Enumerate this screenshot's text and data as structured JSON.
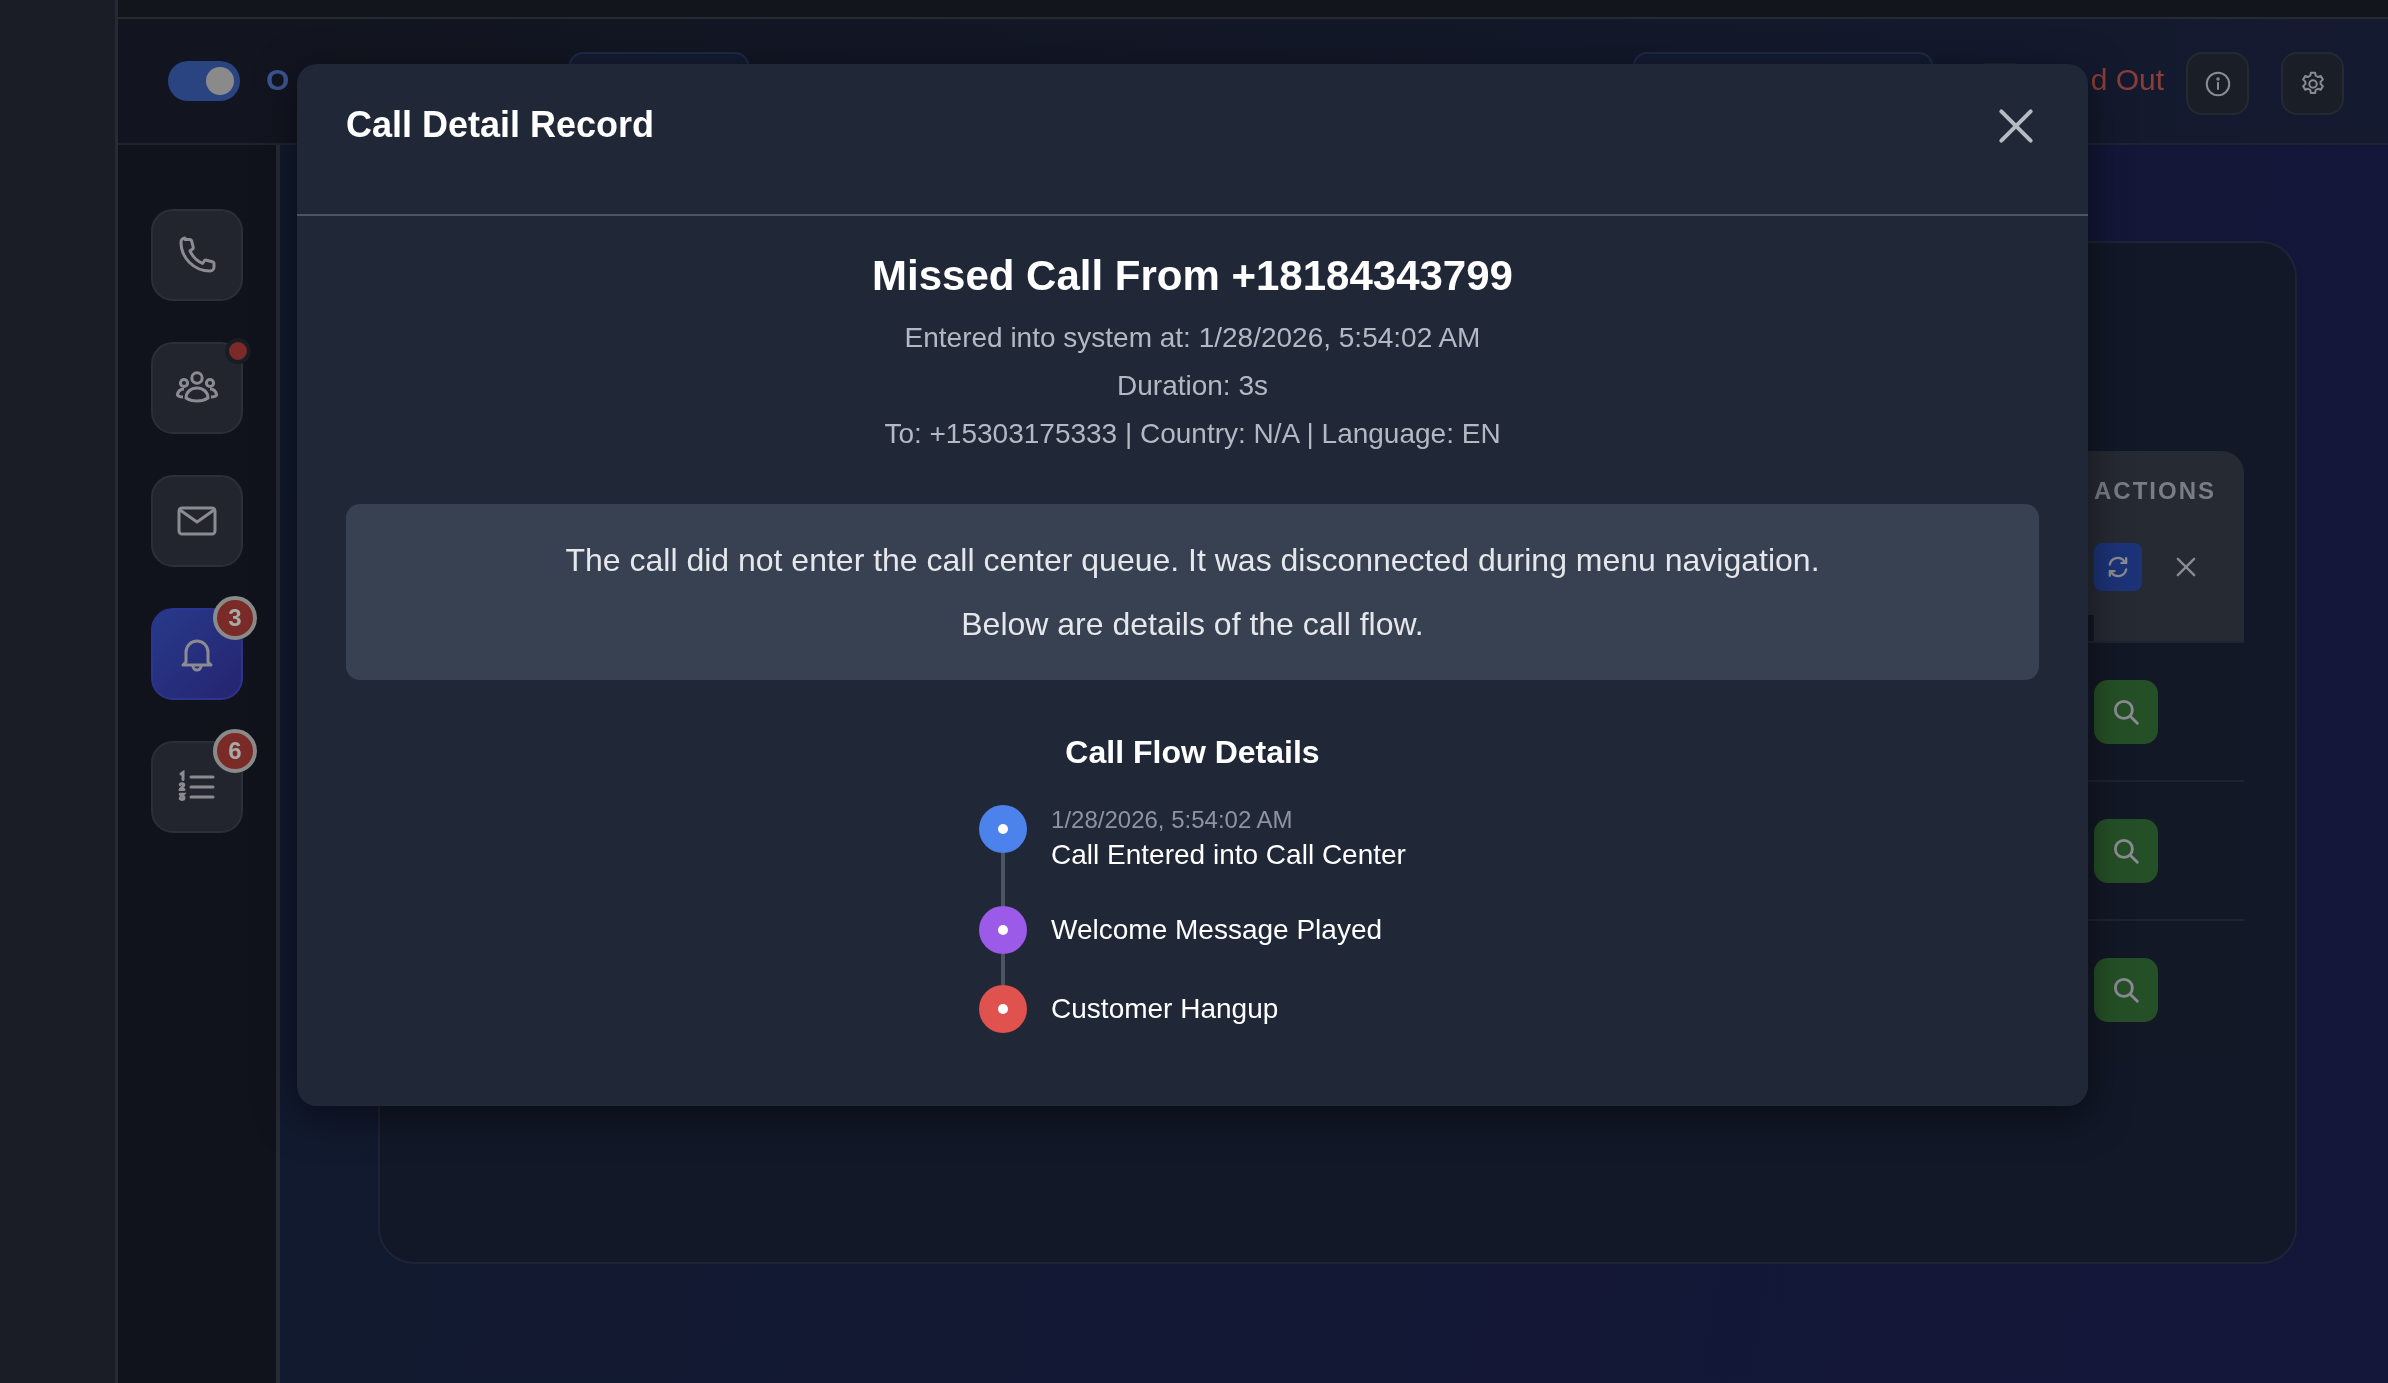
{
  "header": {
    "status_toggle": {
      "on": true
    },
    "status_label": "O",
    "signed_out_label": "d Out"
  },
  "sidebar": {
    "items": [
      {
        "kind": "phone",
        "selected": false,
        "dot": false
      },
      {
        "kind": "people",
        "selected": false,
        "dot": true
      },
      {
        "kind": "mail",
        "selected": false,
        "dot": false
      },
      {
        "kind": "bell",
        "selected": true,
        "dot": false,
        "badge": "3"
      },
      {
        "kind": "list",
        "selected": false,
        "dot": false,
        "badge": "6"
      }
    ]
  },
  "table": {
    "columns": [
      "ACTIONS"
    ],
    "header_actions": [
      {
        "kind": "refresh"
      },
      {
        "kind": "clear"
      }
    ],
    "rows": [
      {
        "actions": [
          {
            "kind": "search"
          }
        ]
      },
      {
        "actions": [
          {
            "kind": "search"
          }
        ]
      },
      {
        "actions": [
          {
            "kind": "search"
          }
        ]
      }
    ]
  },
  "modal": {
    "title": "Call Detail Record",
    "heading": "Missed Call From +18184343799",
    "details": [
      "Entered into system at: 1/28/2026, 5:54:02 AM",
      "Duration: 3s",
      "To: +15303175333 | Country: N/A | Language: EN"
    ],
    "notice": [
      "The call did not enter the call center queue. It was disconnected during menu navigation.",
      "Below are details of the call flow."
    ],
    "flow_title": "Call Flow Details",
    "events": [
      {
        "time": "1/28/2026, 5:54:02 AM",
        "title": "Call Entered into Call Center",
        "color": "#4c82ec"
      },
      {
        "title": "Welcome Message Played",
        "color": "#9b5ae8"
      },
      {
        "title": "Customer Hangup",
        "color": "#e0524e"
      }
    ]
  }
}
